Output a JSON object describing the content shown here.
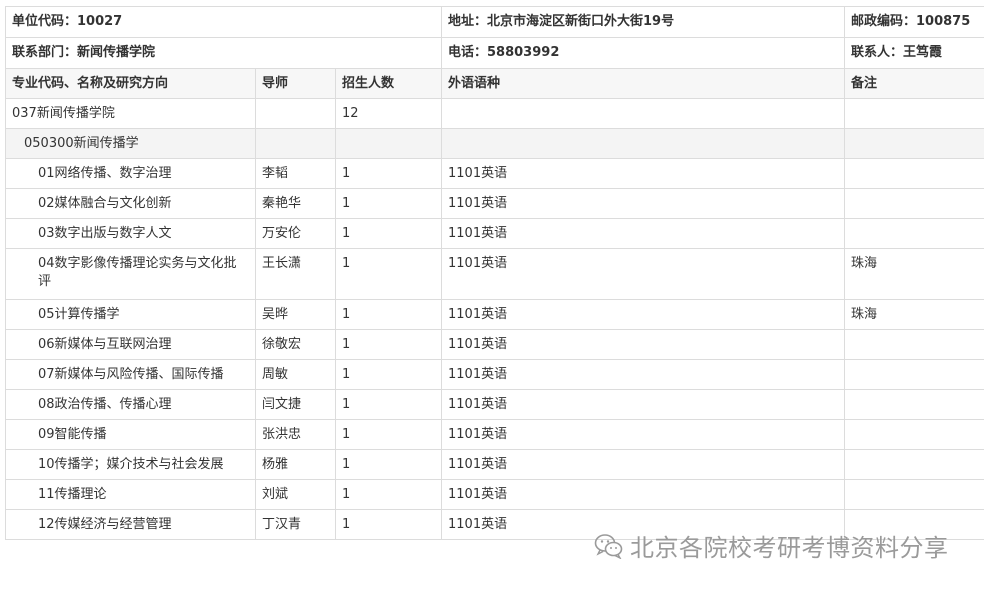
{
  "info": {
    "unit_code": "单位代码：10027",
    "address": "地址：北京市海淀区新街口外大街19号",
    "postcode": "邮政编码：100875",
    "department": "联系部门：新闻传播学院",
    "phone": "电话：58803992",
    "contact": "联系人：王笃霞"
  },
  "headers": {
    "program": "专业代码、名称及研究方向",
    "advisor": "导师",
    "enrollment": "招生人数",
    "language": "外语语种",
    "remarks": "备注"
  },
  "dept": {
    "name": "037新闻传播学院",
    "enrollment": "12"
  },
  "major": {
    "name": "050300新闻传播学"
  },
  "directions": [
    {
      "name": "01网络传播、数字治理",
      "advisor": "李韬",
      "count": "1",
      "language": "1101英语",
      "note": ""
    },
    {
      "name": "02媒体融合与文化创新",
      "advisor": "秦艳华",
      "count": "1",
      "language": "1101英语",
      "note": ""
    },
    {
      "name": "03数字出版与数字人文",
      "advisor": "万安伦",
      "count": "1",
      "language": "1101英语",
      "note": ""
    },
    {
      "name": "04数字影像传播理论实务与文化批评",
      "advisor": "王长潇",
      "count": "1",
      "language": "1101英语",
      "note": "珠海"
    },
    {
      "name": "05计算传播学",
      "advisor": "吴晔",
      "count": "1",
      "language": "1101英语",
      "note": "珠海"
    },
    {
      "name": "06新媒体与互联网治理",
      "advisor": "徐敬宏",
      "count": "1",
      "language": "1101英语",
      "note": ""
    },
    {
      "name": "07新媒体与风险传播、国际传播",
      "advisor": "周敏",
      "count": "1",
      "language": "1101英语",
      "note": ""
    },
    {
      "name": "08政治传播、传播心理",
      "advisor": "闫文捷",
      "count": "1",
      "language": "1101英语",
      "note": ""
    },
    {
      "name": "09智能传播",
      "advisor": "张洪忠",
      "count": "1",
      "language": "1101英语",
      "note": ""
    },
    {
      "name": "10传播学；媒介技术与社会发展",
      "advisor": "杨雅",
      "count": "1",
      "language": "1101英语",
      "note": ""
    },
    {
      "name": "11传播理论",
      "advisor": "刘斌",
      "count": "1",
      "language": "1101英语",
      "note": ""
    },
    {
      "name": "12传媒经济与经营管理",
      "advisor": "丁汉青",
      "count": "1",
      "language": "1101英语",
      "note": ""
    }
  ],
  "watermark": {
    "text": "北京各院校考研考博资料分享",
    "icon": "wechat-icon"
  }
}
